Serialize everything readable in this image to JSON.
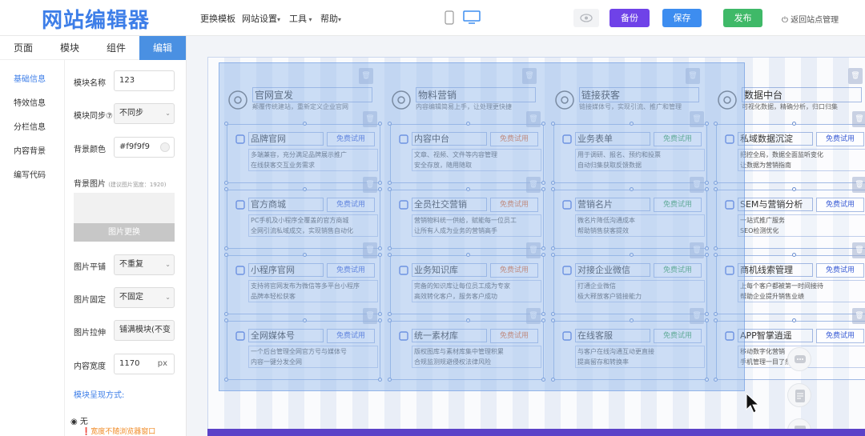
{
  "app": {
    "logo": "网站编辑器"
  },
  "topmenu": {
    "template": "更换模板",
    "settings": "网站设置",
    "tools": "工具",
    "help": "帮助"
  },
  "actions": {
    "backup": "备份",
    "save": "保存",
    "publish": "发布",
    "back": "返回站点管理"
  },
  "colors": {
    "backup": "#6f42e8",
    "save": "#3d8df0",
    "publish": "#3fb968",
    "accent": "#3d7ee8",
    "panel_tab": "#4a90e2",
    "canvas_bar": "#5b42c8"
  },
  "tabs": [
    "页面",
    "模块",
    "组件",
    "编辑"
  ],
  "sidenav": [
    "基础信息",
    "特效信息",
    "分栏信息",
    "内容背景",
    "编写代码"
  ],
  "form": {
    "module_name_label": "模块名称",
    "module_name_value": "123",
    "sync_label": "模块同步⑦",
    "sync_value": "不同步",
    "bgcolor_label": "背景颜色",
    "bgcolor_value": "#f9f9f9",
    "bgimage_label": "背景图片",
    "bgimage_hint": "(建议图片宽度：1920)",
    "change_image": "图片更换",
    "tile_label": "图片平铺",
    "tile_value": "不重复",
    "fixed_label": "图片固定",
    "fixed_value": "不固定",
    "stretch_label": "图片拉伸",
    "stretch_value": "铺满模块(不变",
    "width_label": "内容宽度",
    "width_value": "1170",
    "width_unit": "px",
    "display_label": "模块呈现方式:",
    "radio_none": "无",
    "warn": "宽度不随浏览器窗口"
  },
  "columns": [
    {
      "title": "官网宣发",
      "sub": "颠覆传统建站，重新定义企业官网"
    },
    {
      "title": "物料营销",
      "sub": "内容编辑简易上手，让处理更快捷"
    },
    {
      "title": "链接获客",
      "sub": "链接媒体号，实现引流、推广和管理"
    },
    {
      "title": "数据中台",
      "sub": "可视化数据，精确分析，归口归集"
    }
  ],
  "try_label": "免费试用",
  "cards": [
    [
      {
        "title": "品牌官网",
        "desc1": "多端兼容，充分满足品牌展示推广",
        "desc2": "在线获客交互业务需求"
      },
      {
        "title": "官方商城",
        "desc1": "PC手机及小程序全覆盖的官方商城",
        "desc2": "全网引流私域成交，实现销售自动化"
      },
      {
        "title": "小程序官网",
        "desc1": "支持将官网发布为微信等多平台小程序",
        "desc2": "品牌本轻松获客"
      },
      {
        "title": "全网媒体号",
        "desc1": "一个后台管理全网官方号与媒体号",
        "desc2": "内容一键分发全网"
      }
    ],
    [
      {
        "title": "内容中台",
        "desc1": "文章、视频、文件等内容管理",
        "desc2": "安全存放，随用随取"
      },
      {
        "title": "全员社交营销",
        "desc1": "营销物料统一供给，赋能每一位员工",
        "desc2": "让所有人成为业务的营销高手"
      },
      {
        "title": "业务知识库",
        "desc1": "完备的知识库让每位员工成为专家",
        "desc2": "高效转化客户，服务客户成功"
      },
      {
        "title": "统一素材库",
        "desc1": "版权图库与素材库集中管理积累",
        "desc2": "合规监测规避侵权法律风险"
      }
    ],
    [
      {
        "title": "业务表单",
        "desc1": "用于调研、报名、预约和投票",
        "desc2": "自动归集获取反馈数据"
      },
      {
        "title": "营销名片",
        "desc1": "微名片降低沟通成本",
        "desc2": "帮助销售获客提效"
      },
      {
        "title": "对接企业微信",
        "desc1": "打通企业微信",
        "desc2": "极大释放客户链接能力"
      },
      {
        "title": "在线客服",
        "desc1": "与客户在线沟通互动更直接",
        "desc2": "提高留存和转换率"
      }
    ],
    [
      {
        "title": "私域数据沉淀",
        "desc1": "把控全局，数据全面监听变化",
        "desc2": "让数据为营销指南"
      },
      {
        "title": "SEM与营销分析",
        "desc1": "一站式推广服务",
        "desc2": "SEO检测优化"
      },
      {
        "title": "商机线索管理",
        "desc1": "上每个客户都被第一时间接待",
        "desc2": "帮助企业提升销售业绩"
      },
      {
        "title": "APP智掌逍遥",
        "desc1": "移动数字化营销",
        "desc2": "手机管理一目了然"
      }
    ]
  ],
  "try_colors": [
    "#3d5fd6",
    "#e46a2e",
    "#3fa35b",
    "#3d5fd6"
  ]
}
